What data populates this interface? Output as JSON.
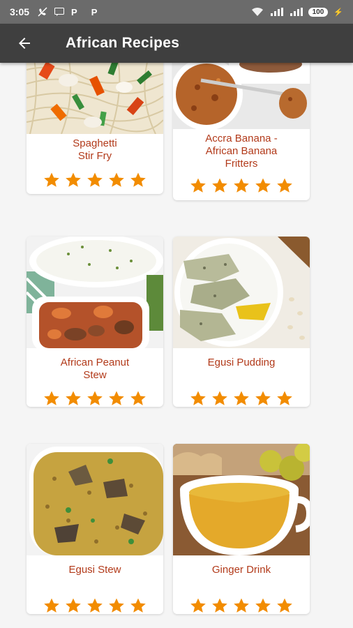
{
  "status_bar": {
    "time": "3:05",
    "battery": "100"
  },
  "app_bar": {
    "title": "African Recipes"
  },
  "recipes": [
    {
      "name": "Spaghetti\nStir Fry",
      "rating": 5
    },
    {
      "name": "Accra Banana -\nAfrican Banana\nFritters",
      "rating": 5
    },
    {
      "name": "African Peanut\nStew",
      "rating": 5
    },
    {
      "name": "Egusi Pudding",
      "rating": 5
    },
    {
      "name": "Egusi Stew",
      "rating": 5
    },
    {
      "name": "Ginger Drink",
      "rating": 5
    }
  ],
  "colors": {
    "app_bar": "#3f3f3f",
    "status_bar": "#6b6b6b",
    "recipe_title": "#b23a1a",
    "star": "#f28c00"
  }
}
